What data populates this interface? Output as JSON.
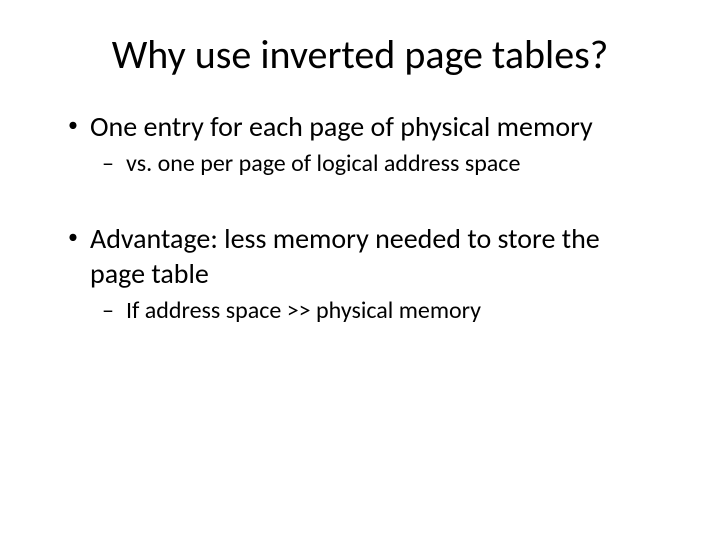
{
  "title": "Why use inverted page tables?",
  "bullets": [
    {
      "text": "One entry for each page of physical memory",
      "sub": [
        {
          "text": "vs. one per page of logical address space"
        }
      ]
    },
    {
      "text": "Advantage: less memory needed to store the page table",
      "sub": [
        {
          "text": "If address space >> physical memory"
        }
      ]
    }
  ]
}
